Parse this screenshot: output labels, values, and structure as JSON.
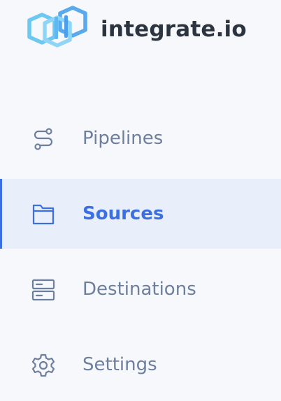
{
  "brand": {
    "name": "integrate.io",
    "logo_icon": "hexagon-logo-icon",
    "accent": "#5bc6f3"
  },
  "nav": {
    "active_color": "#3b6fe2",
    "text_color": "#6e7f9e",
    "items": [
      {
        "label": "Pipelines",
        "icon": "pipelines-icon",
        "active": false
      },
      {
        "label": "Sources",
        "icon": "folder-icon",
        "active": true
      },
      {
        "label": "Destinations",
        "icon": "server-icon",
        "active": false
      },
      {
        "label": "Settings",
        "icon": "gear-icon",
        "active": false
      }
    ]
  }
}
